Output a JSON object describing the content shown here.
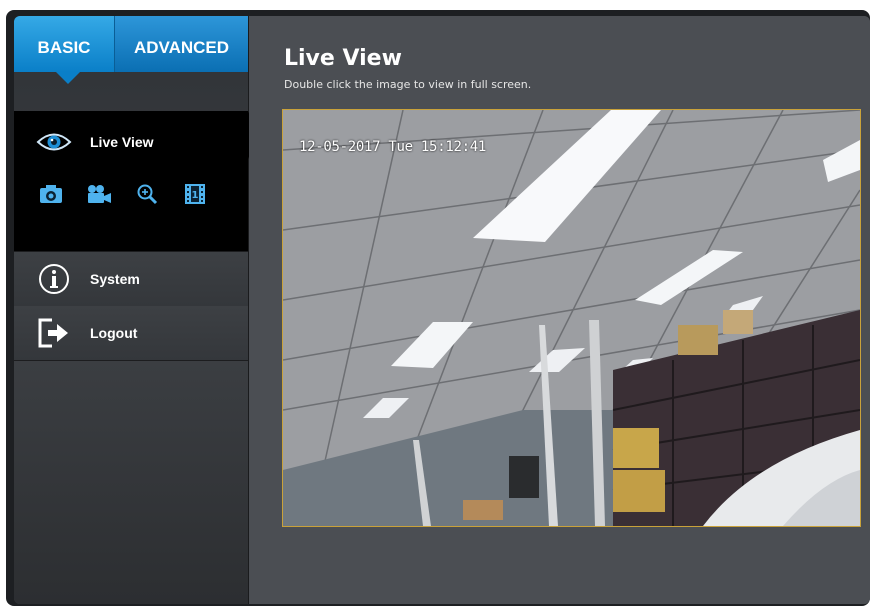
{
  "tabs": {
    "basic": "BASIC",
    "advanced": "ADVANCED"
  },
  "menu": {
    "live_view": "Live View",
    "system": "System",
    "logout": "Logout"
  },
  "tools": [
    {
      "icon": "snapshot-icon"
    },
    {
      "icon": "record-video-icon"
    },
    {
      "icon": "zoom-icon"
    },
    {
      "icon": "film-strip-icon"
    }
  ],
  "page": {
    "title": "Live View",
    "subtitle": "Double click the image to view in full screen."
  },
  "video": {
    "timestamp": "12-05-2017 Tue 15:12:41"
  },
  "colors": {
    "accent": "#0a7fc8",
    "video_border": "#c9a23a"
  }
}
